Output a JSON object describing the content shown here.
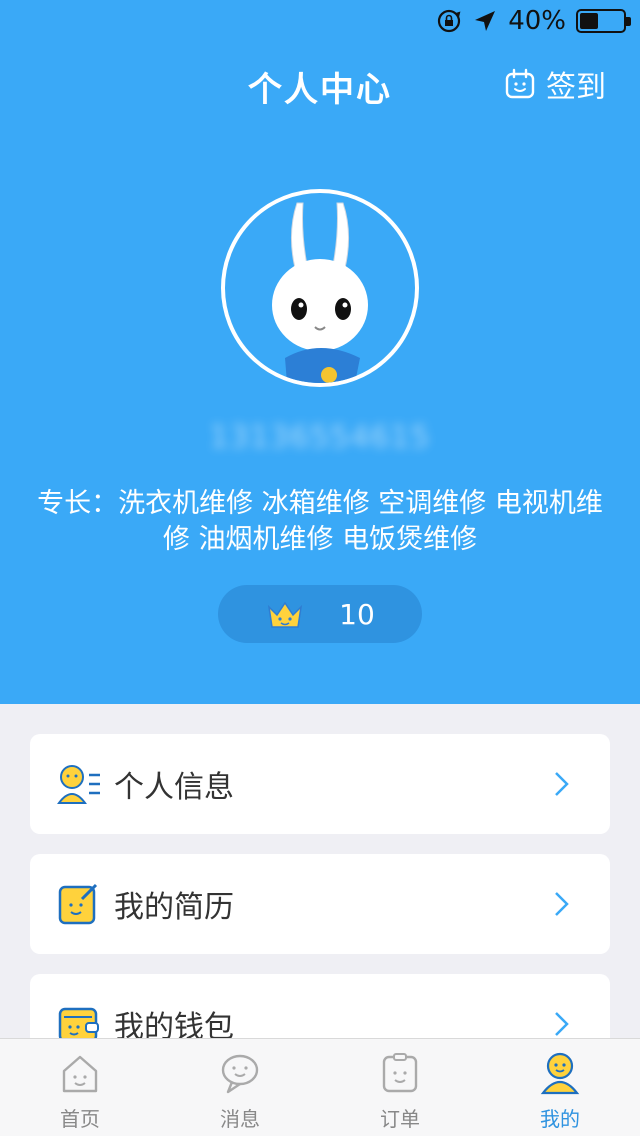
{
  "status_bar": {
    "battery": "40%",
    "battery_level": 0.4
  },
  "header": {
    "title": "个人中心",
    "checkin_label": "签到"
  },
  "profile": {
    "phone": "13136554615",
    "specialty": "专长：洗衣机维修 冰箱维修 空调维修 电视机维修 油烟机维修 电饭煲维修",
    "rating": "10"
  },
  "menu": [
    {
      "label": "个人信息",
      "icon": "personal-info-icon"
    },
    {
      "label": "我的简历",
      "icon": "resume-icon"
    },
    {
      "label": "我的钱包",
      "icon": "wallet-icon"
    }
  ],
  "tabs": [
    {
      "label": "首页",
      "icon": "home-icon"
    },
    {
      "label": "消息",
      "icon": "message-icon"
    },
    {
      "label": "订单",
      "icon": "order-icon"
    },
    {
      "label": "我的",
      "icon": "profile-icon",
      "active": true
    }
  ],
  "colors": {
    "accent": "#3aa9f7",
    "accent_dark": "#2f93e0",
    "icon_yellow": "#ffd23c"
  }
}
